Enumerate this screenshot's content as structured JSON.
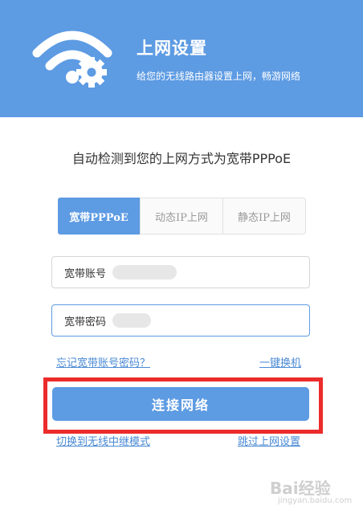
{
  "header": {
    "title": "上网设置",
    "subtitle": "给您的无线路由器设置上网，畅游网络"
  },
  "detect_text": "自动检测到您的上网方式为宽带PPPoE",
  "tabs": [
    {
      "label": "宽带PPPoE",
      "active": true
    },
    {
      "label": "动态IP上网",
      "active": false
    },
    {
      "label": "静态IP上网",
      "active": false
    }
  ],
  "account": {
    "label": "宽带账号",
    "value": "••••••••"
  },
  "password": {
    "label": "宽带密码",
    "value": "••••"
  },
  "links": {
    "forgot": "忘记宽带账号密码？",
    "one_click": "一键换机",
    "relay": "切换到无线中继模式",
    "skip": "跳过上网设置"
  },
  "connect_button": "连接网络",
  "watermark": {
    "brand": "Bai经验",
    "url": "jingyan.baidu.com"
  },
  "colors": {
    "accent": "#5d9be3",
    "highlight": "#ec2b2b",
    "link": "#4a8ad4"
  }
}
